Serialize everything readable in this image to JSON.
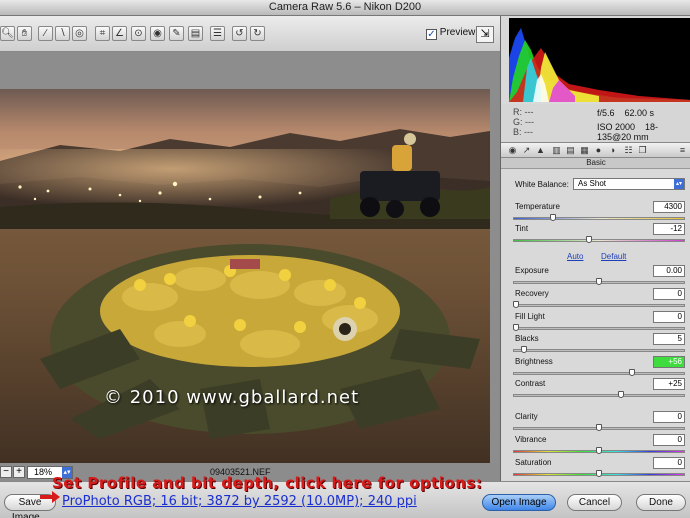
{
  "window": {
    "title": "Camera Raw 5.6  –  Nikon D200"
  },
  "toolbar": {
    "tools": [
      "zoom-icon",
      "hand-icon",
      "white-balance-icon",
      "color-sampler-icon",
      "targeted-adjust-icon",
      "crop-icon",
      "straighten-icon",
      "spot-removal-icon",
      "red-eye-icon",
      "adjustment-brush-icon",
      "graduated-filter-icon",
      "preferences-icon",
      "rotate-left-icon",
      "rotate-right-icon"
    ],
    "preview_label": "Preview",
    "preview_checked": true
  },
  "image": {
    "copyright_text": "© 2010 www.gballard.net"
  },
  "status": {
    "zoom_value": "18%",
    "filename": "09403521.NEF"
  },
  "annotation": {
    "text": "Set Profile and bit depth, click here for options:"
  },
  "workflow_options": "ProPhoto RGB; 16 bit; 3872 by 2592 (10.0MP); 240 ppi",
  "buttons": {
    "save": "Save Image...",
    "open": "Open Image",
    "cancel": "Cancel",
    "done": "Done"
  },
  "readout": {
    "r": "R:   ---",
    "g": "G:   ---",
    "b": "B:   ---",
    "aperture": "f/5.6",
    "shutter": "62.00 s",
    "iso": "ISO 2000",
    "lens": "18-135@20 mm"
  },
  "panel": {
    "title": "Basic",
    "white_balance_label": "White Balance:",
    "white_balance_value": "As Shot",
    "auto_label": "Auto",
    "default_label": "Default",
    "sliders": [
      {
        "label": "Temperature",
        "value": "4300",
        "level": 0.22,
        "track": "temp"
      },
      {
        "label": "Tint",
        "value": "-12",
        "level": 0.44,
        "track": "tint"
      },
      {
        "label": "Exposure",
        "value": "0.00",
        "level": 0.5,
        "track": "gray"
      },
      {
        "label": "Recovery",
        "value": "0",
        "level": 0.0,
        "track": "gray"
      },
      {
        "label": "Fill Light",
        "value": "0",
        "level": 0.0,
        "track": "gray"
      },
      {
        "label": "Blacks",
        "value": "5",
        "level": 0.05,
        "track": "gray"
      },
      {
        "label": "Brightness",
        "value": "+56",
        "level": 0.7,
        "track": "gray",
        "highlight": true
      },
      {
        "label": "Contrast",
        "value": "+25",
        "level": 0.63,
        "track": "gray"
      },
      {
        "label": "Clarity",
        "value": "0",
        "level": 0.5,
        "track": "gray"
      },
      {
        "label": "Vibrance",
        "value": "0",
        "level": 0.5,
        "track": "rainbow"
      },
      {
        "label": "Saturation",
        "value": "0",
        "level": 0.5,
        "track": "rainbow"
      }
    ]
  },
  "colors": {
    "annotation_red": "#d61b1b",
    "link_blue": "#1a2fd0",
    "brightness_highlight": "#3fdc3f"
  }
}
